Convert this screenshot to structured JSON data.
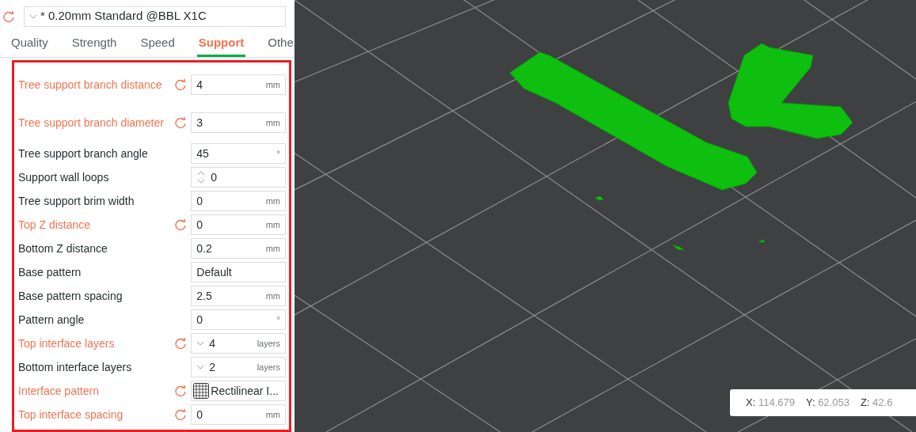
{
  "preset": {
    "value": "* 0.20mm Standard @BBL X1C",
    "modified": true
  },
  "tabs": [
    {
      "label": "Quality",
      "selected": false
    },
    {
      "label": "Strength",
      "selected": false
    },
    {
      "label": "Speed",
      "selected": false
    },
    {
      "label": "Support",
      "selected": true
    },
    {
      "label": "Othe",
      "selected": false
    }
  ],
  "settings": [
    {
      "label": "Tree support branch distance",
      "modified": true,
      "kind": "unit",
      "value": "4",
      "unit": "mm"
    },
    {
      "label": "Tree support branch diameter",
      "modified": true,
      "kind": "unit",
      "value": "3",
      "unit": "mm"
    },
    {
      "label": "Tree support branch angle",
      "modified": false,
      "kind": "unit",
      "value": "45",
      "unit": "°"
    },
    {
      "label": "Support wall loops",
      "modified": false,
      "kind": "spin",
      "value": "0"
    },
    {
      "label": "Tree support brim width",
      "modified": false,
      "kind": "unit",
      "value": "0",
      "unit": "mm"
    },
    {
      "label": "Top Z distance",
      "modified": true,
      "kind": "unit",
      "value": "0",
      "unit": "mm"
    },
    {
      "label": "Bottom Z distance",
      "modified": false,
      "kind": "unit",
      "value": "0.2",
      "unit": "mm"
    },
    {
      "label": "Base pattern",
      "modified": false,
      "kind": "text",
      "value": "Default"
    },
    {
      "label": "Base pattern spacing",
      "modified": false,
      "kind": "unit",
      "value": "2.5",
      "unit": "mm"
    },
    {
      "label": "Pattern angle",
      "modified": false,
      "kind": "unit",
      "value": "0",
      "unit": "°"
    },
    {
      "label": "Top interface layers",
      "modified": true,
      "kind": "dropdown",
      "value": "4",
      "unit": "layers"
    },
    {
      "label": "Bottom interface layers",
      "modified": false,
      "kind": "dropdown",
      "value": "2",
      "unit": "layers"
    },
    {
      "label": "Interface pattern",
      "modified": true,
      "kind": "pattern",
      "value": "Rectilinear I..."
    },
    {
      "label": "Top interface spacing",
      "modified": true,
      "kind": "unit",
      "value": "0",
      "unit": "mm"
    }
  ],
  "coordinates": [
    {
      "axis": "X:",
      "value": "114.679"
    },
    {
      "axis": "Y:",
      "value": "62.053"
    },
    {
      "axis": "Z:",
      "value": "42.6"
    }
  ]
}
